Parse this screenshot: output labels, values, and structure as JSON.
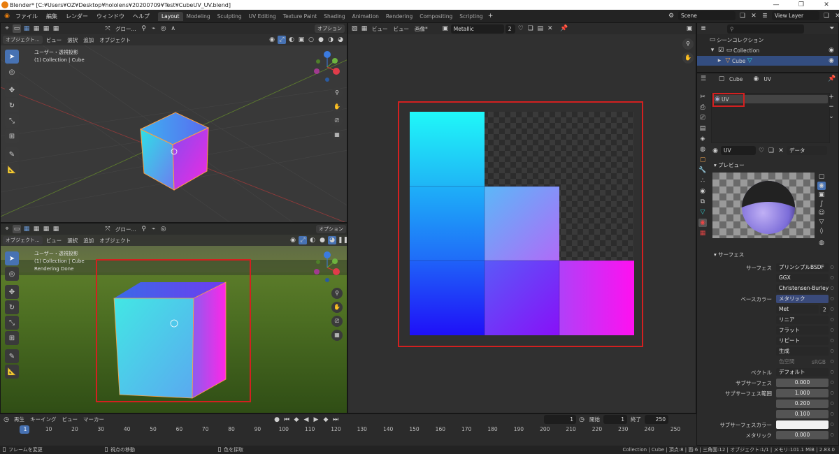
{
  "window": {
    "title": "Blender* [C:¥Users¥OZ¥Desktop¥hololens¥20200709¥Test¥CubeUV_UV.blend]"
  },
  "menu": [
    "ファイル",
    "編集",
    "レンダー",
    "ウィンドウ",
    "ヘルプ"
  ],
  "workspace_tabs": [
    "Layout",
    "Modeling",
    "Sculpting",
    "UV Editing",
    "Texture Paint",
    "Shading",
    "Animation",
    "Rendering",
    "Compositing",
    "Scripting"
  ],
  "active_tab": "Layout",
  "scene": {
    "scene_name": "Scene",
    "view_layer": "View Layer"
  },
  "viewport_top": {
    "header_glo": "グロー...",
    "options": "オプション",
    "mode": "オブジェクト...",
    "menus": [
      "ビュー",
      "選択",
      "追加",
      "オブジェクト"
    ],
    "overlay_line1": "ユーザー・透視投影",
    "overlay_line2": "(1) Collection | Cube"
  },
  "viewport_bottom": {
    "header_glo": "グロー...",
    "options": "オプション",
    "mode": "オブジェクト...",
    "menus": [
      "ビュー",
      "選択",
      "追加",
      "オブジェクト"
    ],
    "overlay_line1": "ユーザー・透視投影",
    "overlay_line2": "(1) Collection | Cube",
    "overlay_line3": "Rendering Done"
  },
  "image_editor": {
    "menus": [
      "ビュー",
      "ビュー",
      "画像*"
    ],
    "image_name": "Metallic",
    "users": "2"
  },
  "outliner": {
    "title": "シーンコレクション",
    "collection": "Collection",
    "object": "Cube"
  },
  "properties": {
    "breadcrumb_object": "Cube",
    "breadcrumb_data": "UV",
    "uv_slot": "UV",
    "material_name": "UV",
    "data_link": "データ",
    "preview_label": "プレビュー",
    "surface_label": "サーフェス",
    "rows": [
      {
        "label": "サーフェス",
        "value": "プリンシプルBSDF",
        "kind": "dd"
      },
      {
        "label": "",
        "value": "GGX",
        "kind": "dd"
      },
      {
        "label": "",
        "value": "Christensen-Burley",
        "kind": "dd"
      },
      {
        "label": "ベースカラー",
        "value": "メタリック",
        "kind": "blue"
      },
      {
        "label": "",
        "value": "Met",
        "kind": "img"
      },
      {
        "label": "",
        "value": "リニア",
        "kind": "dd"
      },
      {
        "label": "",
        "value": "フラット",
        "kind": "dd"
      },
      {
        "label": "",
        "value": "リピート",
        "kind": "dd"
      },
      {
        "label": "",
        "value": "生成",
        "kind": "dd"
      },
      {
        "label": "",
        "value": "色空間",
        "kind": "cs"
      },
      {
        "label": "ベクトル",
        "value": "デフォルト",
        "kind": "dd"
      },
      {
        "label": "サブサーフェス",
        "value": "0.000",
        "kind": "num"
      },
      {
        "label": "サブサーフェス範囲",
        "value": "1.000",
        "kind": "num"
      },
      {
        "label": "",
        "value": "0.200",
        "kind": "num"
      },
      {
        "label": "",
        "value": "0.100",
        "kind": "num"
      },
      {
        "label": "サブサーフェスカラー",
        "value": "",
        "kind": "white"
      },
      {
        "label": "メタリック",
        "value": "0.000",
        "kind": "num"
      }
    ],
    "colorspace_value": "sRGB",
    "img_users": "2"
  },
  "timeline": {
    "menus": [
      "再生",
      "キーイング",
      "ビュー",
      "マーカー"
    ],
    "current_frame": "1",
    "start_label": "開始",
    "start": "1",
    "end_label": "終了",
    "end": "250",
    "ticks": [
      "1",
      "10",
      "20",
      "30",
      "40",
      "50",
      "60",
      "70",
      "80",
      "90",
      "100",
      "110",
      "120",
      "130",
      "140",
      "150",
      "160",
      "170",
      "180",
      "190",
      "200",
      "210",
      "220",
      "230",
      "240",
      "250"
    ]
  },
  "statusbar": {
    "left1": "フレームを変更",
    "left2": "視点の移動",
    "left3": "色を採取",
    "right": "Collection | Cube | 頂点:8 | 面:6 | 三角面:12 | オブジェクト:1/1 | メモリ:101.1 MiB | 2.83.0"
  }
}
